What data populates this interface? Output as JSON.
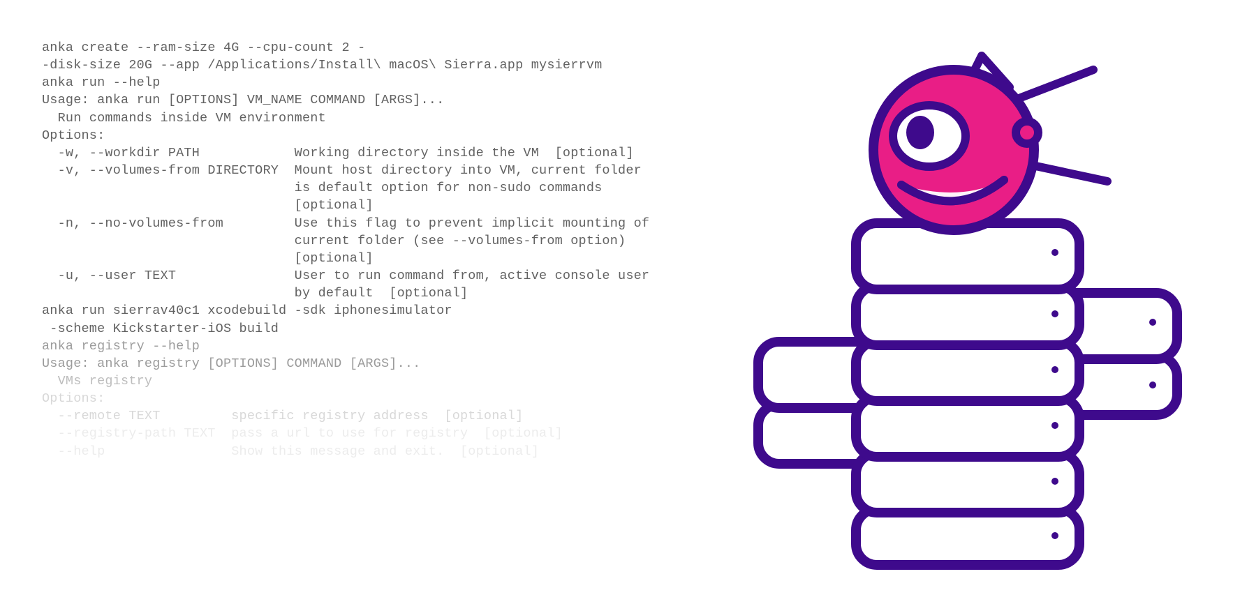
{
  "colors": {
    "text": "#626262",
    "fade1": "#9b9b9b",
    "fade2": "#bdbdbd",
    "fade3": "#d8d8d8",
    "fade4": "#ececec",
    "purple": "#3E0A8C",
    "pink": "#E91E86",
    "white": "#ffffff"
  },
  "terminal": {
    "lines": [
      {
        "t": "anka create --ram-size 4G --cpu-count 2 -",
        "c": "n"
      },
      {
        "t": "-disk-size 20G --app /Applications/Install\\ macOS\\ Sierra.app mysierrvm",
        "c": "n"
      },
      {
        "t": "",
        "c": "n"
      },
      {
        "t": "anka run --help",
        "c": "n"
      },
      {
        "t": "Usage: anka run [OPTIONS] VM_NAME COMMAND [ARGS]...",
        "c": "n"
      },
      {
        "t": "",
        "c": "n"
      },
      {
        "t": "  Run commands inside VM environment",
        "c": "n"
      },
      {
        "t": "",
        "c": "n"
      },
      {
        "t": "Options:",
        "c": "n"
      },
      {
        "t": "  -w, --workdir PATH            Working directory inside the VM  [optional]",
        "c": "n"
      },
      {
        "t": "  -v, --volumes-from DIRECTORY  Mount host directory into VM, current folder",
        "c": "n"
      },
      {
        "t": "                                is default option for non-sudo commands",
        "c": "n"
      },
      {
        "t": "                                [optional]",
        "c": "n"
      },
      {
        "t": "  -n, --no-volumes-from         Use this flag to prevent implicit mounting of",
        "c": "n"
      },
      {
        "t": "                                current folder (see --volumes-from option)",
        "c": "n"
      },
      {
        "t": "                                [optional]",
        "c": "n"
      },
      {
        "t": "  -u, --user TEXT               User to run command from, active console user",
        "c": "n"
      },
      {
        "t": "                                by default  [optional]",
        "c": "n"
      },
      {
        "t": "",
        "c": "n"
      },
      {
        "t": "anka run sierrav40c1 xcodebuild -sdk iphonesimulator",
        "c": "n"
      },
      {
        "t": " -scheme Kickstarter-iOS build",
        "c": "n"
      },
      {
        "t": "",
        "c": "n"
      },
      {
        "t": "anka registry --help",
        "c": "f1"
      },
      {
        "t": "Usage: anka registry [OPTIONS] COMMAND [ARGS]...",
        "c": "f1"
      },
      {
        "t": "",
        "c": "f1"
      },
      {
        "t": "  VMs registry",
        "c": "f2"
      },
      {
        "t": "",
        "c": "f2"
      },
      {
        "t": "Options:",
        "c": "f3"
      },
      {
        "t": "  --remote TEXT         specific registry address  [optional]",
        "c": "f3"
      },
      {
        "t": "  --registry-path TEXT  pass a url to use for registry  [optional]",
        "c": "f4"
      },
      {
        "t": "  --help                Show this message and exit.  [optional]",
        "c": "f4"
      }
    ]
  }
}
